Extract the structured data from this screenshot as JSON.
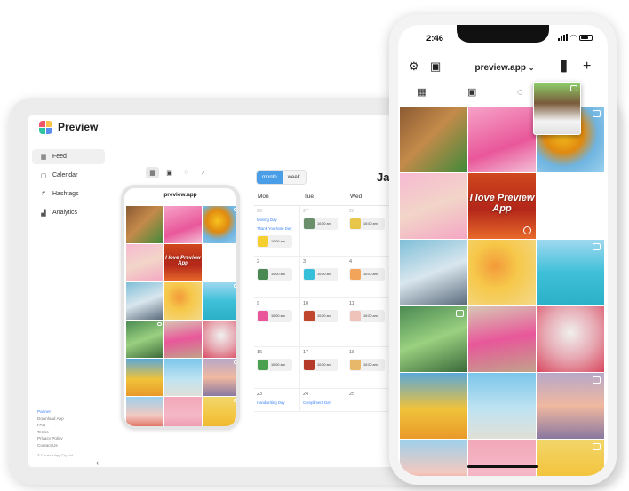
{
  "desktop": {
    "brand": "Preview",
    "logo_colors": [
      "#f2556a",
      "#ffc24b",
      "#2ec4a0",
      "#5a8df0"
    ],
    "sidebar": {
      "items": [
        {
          "label": "Feed",
          "icon": "grid-icon",
          "glyph": "▦",
          "active": true
        },
        {
          "label": "Calendar",
          "icon": "calendar-icon",
          "glyph": "▢",
          "active": false
        },
        {
          "label": "Hashtags",
          "icon": "hash-icon",
          "glyph": "#",
          "active": false
        },
        {
          "label": "Analytics",
          "icon": "bar-chart-icon",
          "glyph": "▟",
          "active": false
        }
      ],
      "footer": {
        "partner": "Partner",
        "links": [
          "Download App",
          "FAQ",
          "Terms",
          "Privacy Policy",
          "Contact Us"
        ],
        "copyright": "© Preview App Pty Ltd"
      },
      "collapse": "‹"
    },
    "view_toggles": [
      {
        "icon": "grid-icon",
        "glyph": "▦"
      },
      {
        "icon": "reels-icon",
        "glyph": "▣"
      },
      {
        "icon": "stories-icon",
        "glyph": "◌"
      },
      {
        "icon": "tiktok-icon",
        "glyph": "♪"
      }
    ],
    "mini_phone": {
      "title": "preview.app",
      "tile_text": "I love Preview App"
    },
    "calendar": {
      "views": [
        "month",
        "week"
      ],
      "active_view": "month",
      "title": "Ja",
      "days": [
        "Mon",
        "Tue",
        "Wed"
      ],
      "weeks": [
        [
          {
            "day": "26",
            "faded": true,
            "events": [
              "Moving Day",
              "Thank You Note Day"
            ],
            "posts": [
              {
                "time": "10:00 am",
                "color": "#f5cf2e"
              }
            ]
          },
          {
            "day": "27",
            "faded": true,
            "events": [],
            "posts": [
              {
                "time": "10:00 am",
                "color": "#6b8f6a"
              }
            ]
          },
          {
            "day": "28",
            "faded": true,
            "events": [],
            "posts": [
              {
                "time": "10:00 am",
                "color": "#e8c64a"
              }
            ]
          }
        ],
        [
          {
            "day": "2",
            "faded": false,
            "events": [],
            "posts": [
              {
                "time": "10:00 am",
                "color": "#4a8a52"
              }
            ]
          },
          {
            "day": "3",
            "faded": false,
            "events": [],
            "posts": [
              {
                "time": "10:00 am",
                "color": "#36bfd8"
              }
            ]
          },
          {
            "day": "4",
            "faded": false,
            "events": [],
            "posts": [
              {
                "time": "10:00 am",
                "color": "#f2a45a"
              }
            ]
          }
        ],
        [
          {
            "day": "9",
            "faded": false,
            "events": [],
            "posts": [
              {
                "time": "10:00 am",
                "color": "#e9579a"
              }
            ]
          },
          {
            "day": "10",
            "faded": false,
            "events": [],
            "posts": [
              {
                "time": "10:00 am",
                "color": "#c0472e"
              }
            ]
          },
          {
            "day": "11",
            "faded": false,
            "events": [],
            "posts": [
              {
                "time": "10:00 am",
                "color": "#f0c3ba"
              }
            ]
          }
        ],
        [
          {
            "day": "16",
            "faded": false,
            "events": [],
            "posts": [
              {
                "time": "10:00 am",
                "color": "#4aa04e"
              }
            ]
          },
          {
            "day": "17",
            "faded": false,
            "events": [],
            "posts": [
              {
                "time": "10:00 am",
                "color": "#b53a2a"
              }
            ]
          },
          {
            "day": "18",
            "faded": false,
            "events": [],
            "posts": [
              {
                "time": "10:00 am",
                "color": "#e7b86a"
              }
            ]
          }
        ],
        [
          {
            "day": "23",
            "faded": false,
            "events": [
              "Handwriting Day"
            ],
            "posts": []
          },
          {
            "day": "24",
            "faded": false,
            "events": [
              "Compliment Day"
            ],
            "posts": []
          },
          {
            "day": "25",
            "faded": false,
            "events": [],
            "posts": []
          }
        ]
      ]
    }
  },
  "phone": {
    "time": "2:46",
    "account": "preview.app",
    "tile_text": "I love Preview App",
    "top_icons": [
      {
        "icon": "gear-icon",
        "glyph": "⚙"
      },
      {
        "icon": "calendar-icon",
        "glyph": "▣"
      },
      {
        "icon": "bar-chart-icon",
        "glyph": "▐▌"
      },
      {
        "icon": "plus-icon",
        "glyph": "+"
      }
    ],
    "grid_tabs": [
      {
        "icon": "grid-icon",
        "glyph": "▦"
      },
      {
        "icon": "reels-icon",
        "glyph": "▣"
      },
      {
        "icon": "stories-icon",
        "glyph": "◌"
      },
      {
        "icon": "tiktok-icon",
        "glyph": "♪"
      }
    ]
  },
  "grid_tiles": [
    {
      "bg": "linear-gradient(135deg,#8a5a32 0%,#c48a4a 45%,#3f8a3a 100%)",
      "reel": false
    },
    {
      "bg": "linear-gradient(160deg,#f6a3c8 0%,#e9579a 60%,#f3c2d8 100%)",
      "reel": false
    },
    {
      "bg": "radial-gradient(circle at 40% 40%,#f7c21e 0%,#e08a10 35%,#6fb4e0 60%,#9ad0ee 100%)",
      "reel": true
    },
    {
      "bg": "linear-gradient(160deg,#f7b9d2 0%,#f2d5c8 50%,#f4a6c4 100%)",
      "reel": false
    },
    {
      "bg": "linear-gradient(180deg,#d0481e 0%,#b3261a 55%,#e86a2a 100%)",
      "reel": false,
      "text": true,
      "clock": true
    },
    {
      "bg": "linear-gradient(180deg,#ffffff 0%,#ffffff 100%)",
      "reel": false
    },
    {
      "bg": "linear-gradient(160deg,#7fbfd8 0%,#d9e6ee 50%,#5a6a7a 100%)",
      "reel": false
    },
    {
      "bg": "radial-gradient(circle at 40% 40%,#f39a3a 0%,#f6c84a 40%,#f3d98a 100%)",
      "reel": false
    },
    {
      "bg": "linear-gradient(180deg,#9fd8f0 0%,#3fc0d8 50%,#2ab0c8 100%)",
      "reel": true
    },
    {
      "bg": "linear-gradient(160deg,#4a8a52 0%,#9ad080 50%,#3a6a3a 100%)",
      "reel": true
    },
    {
      "bg": "linear-gradient(170deg,#d7c7b3 0%,#e8579a 50%,#c2a28a 100%)",
      "reel": false
    },
    {
      "bg": "radial-gradient(circle at 50% 40%,#f0f0ee 0%,#e7a8b2 50%,#d94860 100%)",
      "reel": false
    },
    {
      "bg": "linear-gradient(180deg,#5aa8d8 0%,#f0c23a 55%,#e89a2a 100%)",
      "reel": false
    },
    {
      "bg": "linear-gradient(180deg,#7cc6ea 0%,#bfe3f2 55%,#e0e0d6 100%)",
      "reel": false
    },
    {
      "bg": "linear-gradient(180deg,#b7a8c8 0%,#f0b8a0 50%,#8a78a0 100%)",
      "reel": true
    },
    {
      "bg": "linear-gradient(180deg,#9ed0ec 0%,#f2c9c0 50%,#d43a2a 100%)",
      "reel": false
    },
    {
      "bg": "linear-gradient(180deg,#f2a8b8 0%,#f5b8c6 50%,#e98aa0 100%)",
      "reel": false
    },
    {
      "bg": "linear-gradient(180deg,#f2d66a 0%,#f3c23a 60%,#e8b02a 100%)",
      "reel": true
    }
  ],
  "overlay_tile": {
    "bg": "linear-gradient(180deg,#8ed06a 0%,#7a5a3a 40%,#f4f4f4 75%,#e0e0e0 100%)"
  }
}
